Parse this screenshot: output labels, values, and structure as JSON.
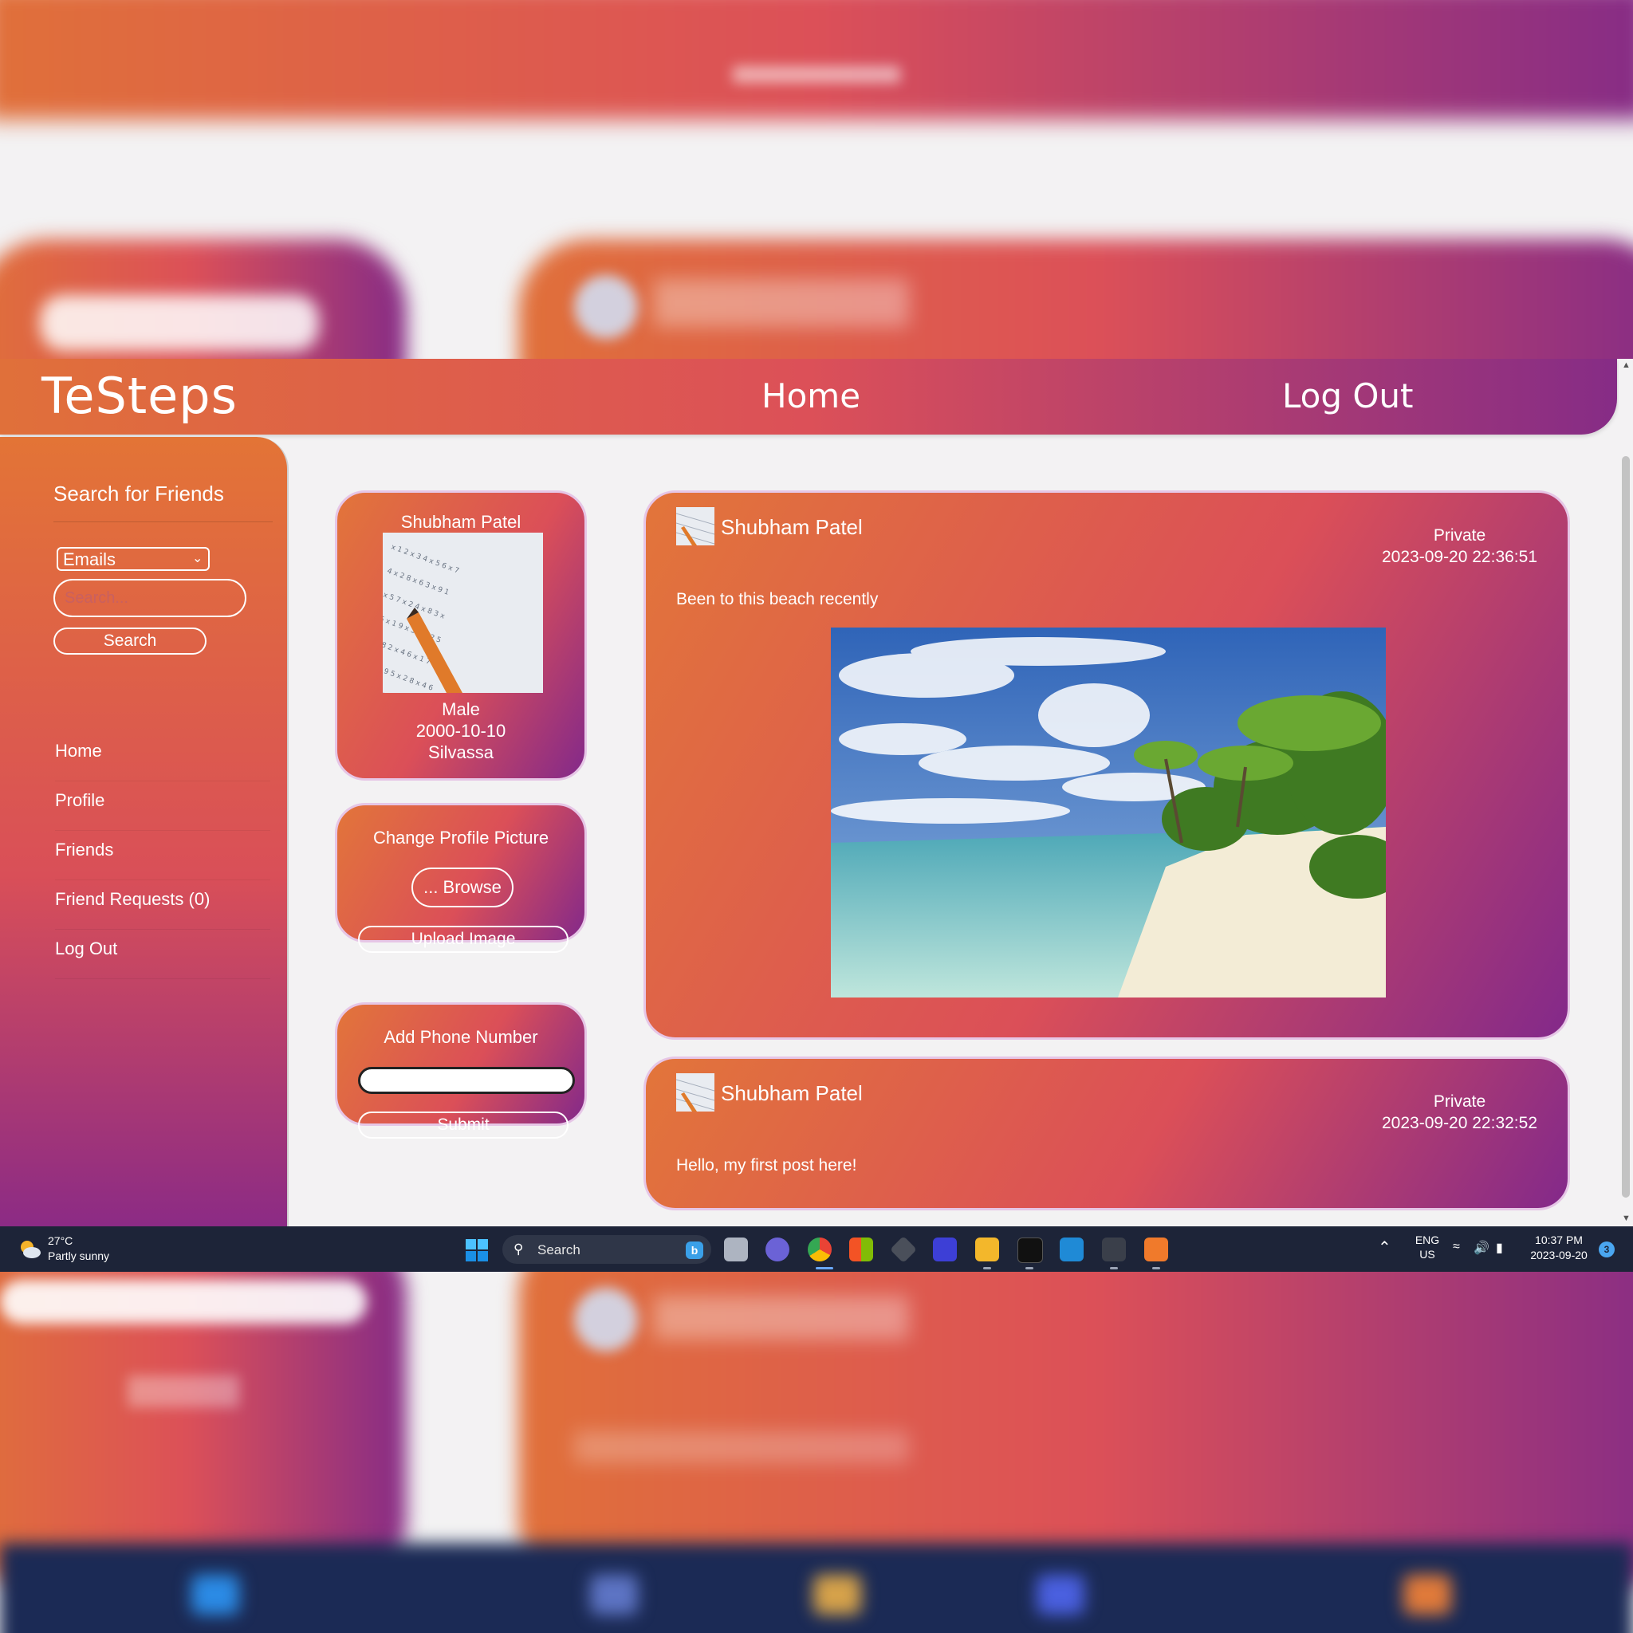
{
  "app": {
    "brand": "TeSteps",
    "nav": {
      "home": "Home",
      "logout": "Log Out"
    }
  },
  "sidebar": {
    "title": "Search for Friends",
    "filter_selected": "Emails",
    "search_placeholder": "Search...",
    "search_button": "Search",
    "menu": [
      {
        "label": "Home"
      },
      {
        "label": "Profile"
      },
      {
        "label": "Friends"
      },
      {
        "label": "Friend Requests (0)"
      },
      {
        "label": "Log Out"
      }
    ]
  },
  "profile": {
    "name": "Shubham Patel",
    "gender": "Male",
    "birthdate": "2000-10-10",
    "city": "Silvassa"
  },
  "change_picture": {
    "title": "Change Profile Picture",
    "browse_label": "... Browse",
    "upload_label": "Upload Image"
  },
  "phone": {
    "title": "Add Phone Number",
    "value": "",
    "submit_label": "Submit"
  },
  "posts": [
    {
      "author": "Shubham Patel",
      "privacy": "Private",
      "timestamp": "2023-09-20 22:36:51",
      "text": "Been to this beach recently"
    },
    {
      "author": "Shubham Patel",
      "privacy": "Private",
      "timestamp": "2023-09-20 22:32:52",
      "text": "Hello, my first post here!"
    }
  ],
  "taskbar": {
    "temperature": "27°C",
    "condition": "Partly sunny",
    "search_label": "Search",
    "lang_top": "ENG",
    "lang_bottom": "US",
    "time": "10:37 PM",
    "date": "2023-09-20",
    "notification_count": "3",
    "icons": [
      "start-icon",
      "task-view-icon",
      "teams-chat-icon",
      "chrome-icon",
      "store-icon",
      "unity-icon",
      "app-icon",
      "file-explorer-icon",
      "epic-games-icon",
      "vscode-icon",
      "terminal-icon",
      "xampp-icon"
    ]
  },
  "colors": {
    "gradient_start": "#e0703a",
    "gradient_mid": "#dc5058",
    "gradient_end": "#862c86",
    "page_background": "#f3f2f3",
    "taskbar": "#1d2438"
  }
}
